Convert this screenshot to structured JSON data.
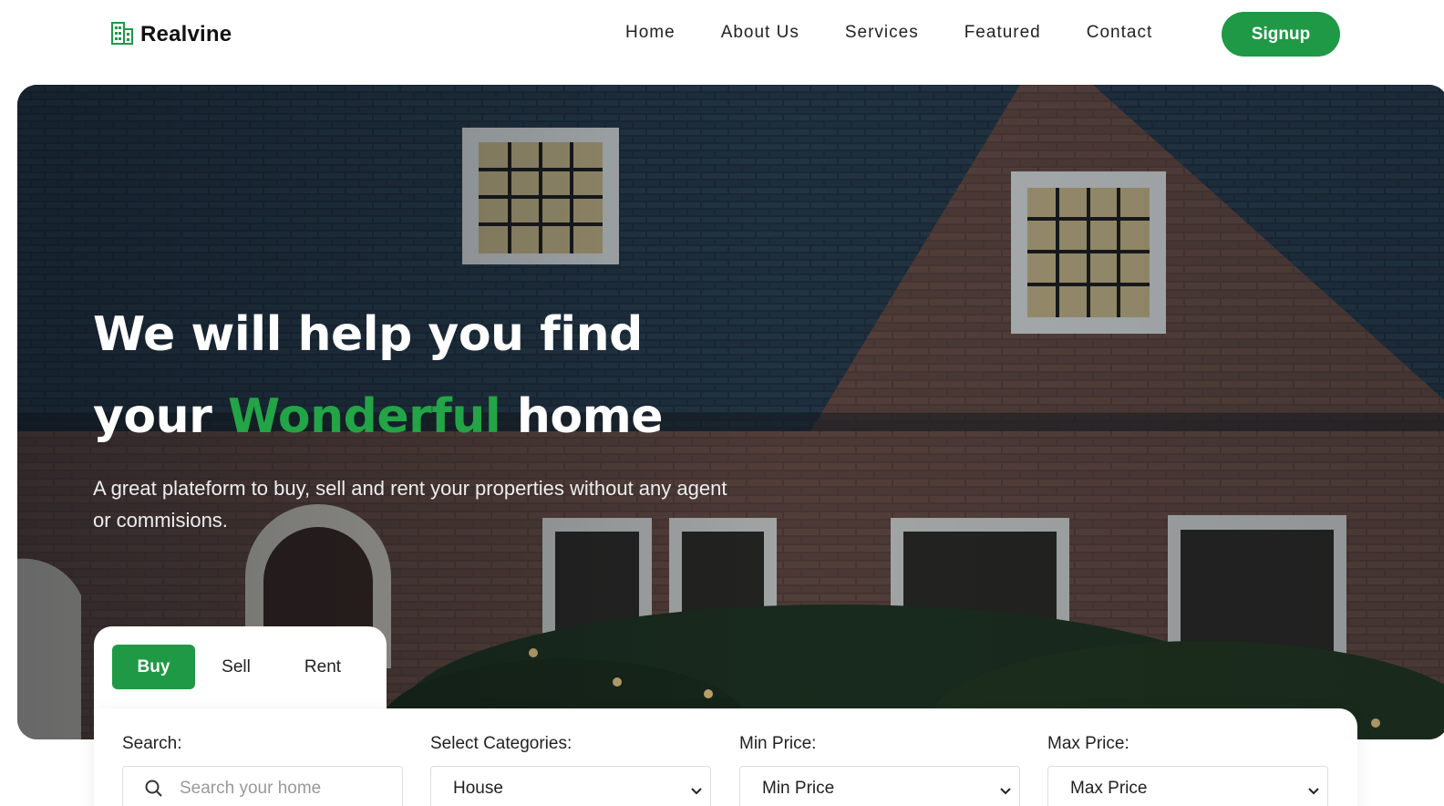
{
  "brand": {
    "name": "Realvine",
    "accent": "#1f9945"
  },
  "nav": {
    "items": [
      "Home",
      "About Us",
      "Services",
      "Featured",
      "Contact"
    ],
    "signup": "Signup"
  },
  "hero": {
    "headline_line1": "We will help you find",
    "headline_line2_before": "your",
    "headline_line2_accent": "Wonderful",
    "headline_line2_after": "home",
    "subtitle": "A great plateform to buy, sell and rent your properties without any agent or commisions."
  },
  "tabs": {
    "buy": "Buy",
    "sell": "Sell",
    "rent": "Rent",
    "active": "Buy"
  },
  "search": {
    "search_label": "Search:",
    "search_placeholder": "Search your home",
    "category_label": "Select Categories:",
    "category_value": "House",
    "min_label": "Min Price:",
    "min_value": "Min Price",
    "max_label": "Max Price:",
    "max_value": "Max Price"
  }
}
